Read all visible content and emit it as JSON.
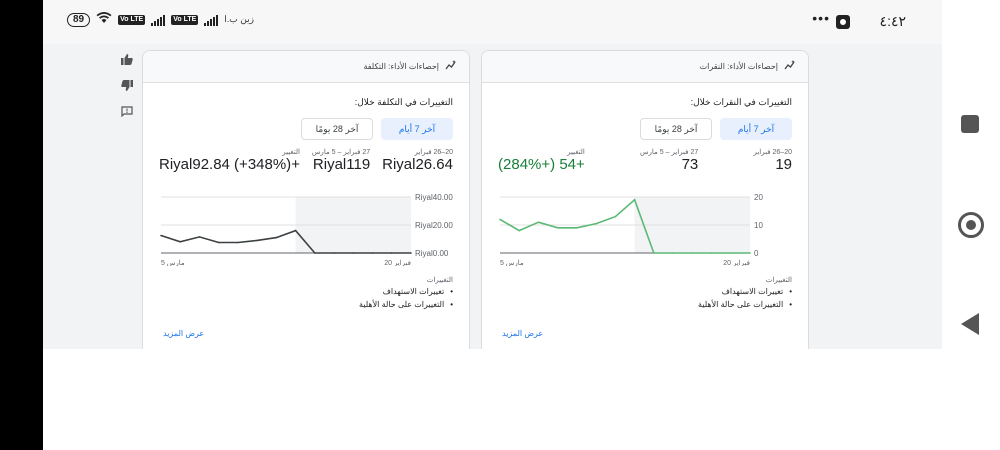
{
  "status_bar": {
    "time": "٤:٤٢",
    "battery": "89",
    "lte": "Vo LTE",
    "carrier": "زين ب.ا"
  },
  "side_actions": [
    "thumb-up-icon",
    "thumb-down-icon",
    "feedback-icon"
  ],
  "cards": [
    {
      "title": "إحصاءات الأداء: التكلفة",
      "subtitle": "التغييرات في التكلفة خلال:",
      "toggle": [
        "آخر 7 أيام",
        "آخر 28 يومًا"
      ],
      "metrics": [
        {
          "label": "20–26 فبراير",
          "value": "Riyal26.64"
        },
        {
          "label": "27 فبراير – 5 مارس",
          "value": "Riyal119"
        },
        {
          "label": "التغيير",
          "value": "+Riyal92.84 (+348%)"
        }
      ],
      "changes_label": "التغييرات",
      "changes": [
        "تغييرات الاستهداف",
        "التغييرات على حالة الأهلية"
      ],
      "more": "عرض المزيد",
      "chart_data": {
        "type": "line",
        "x_labels": [
          "5 مارس",
          "20 فبراير"
        ],
        "y_ticks": [
          "Riyal40.00",
          "Riyal20.00",
          "Riyal0.00"
        ],
        "ylim": [
          0,
          40
        ],
        "values": [
          12.5,
          8,
          11.5,
          7.5,
          7.5,
          9,
          11,
          16,
          0,
          0,
          0,
          0,
          0,
          0
        ],
        "color": "#3c4043"
      }
    },
    {
      "title": "إحصاءات الأداء: النقرات",
      "subtitle": "التغييرات في النقرات خلال:",
      "toggle": [
        "آخر 7 أيام",
        "آخر 28 يومًا"
      ],
      "metrics": [
        {
          "label": "20–26 فبراير",
          "value": "19"
        },
        {
          "label": "27 فبراير – 5 مارس",
          "value": "73"
        },
        {
          "label": "التغيير",
          "value": "+54 (+284%)"
        }
      ],
      "changes_label": "التغييرات",
      "changes": [
        "تغييرات الاستهداف",
        "التغييرات على حالة الأهلية"
      ],
      "more": "عرض المزيد",
      "chart_data": {
        "type": "line",
        "x_labels": [
          "5 مارس",
          "20 فبراير"
        ],
        "y_ticks": [
          "20",
          "10",
          "0"
        ],
        "ylim": [
          0,
          20
        ],
        "values": [
          12,
          8,
          11,
          9,
          9,
          10.5,
          13,
          19,
          0,
          0,
          0,
          0,
          0,
          0
        ],
        "color": "#5bb974"
      }
    }
  ]
}
